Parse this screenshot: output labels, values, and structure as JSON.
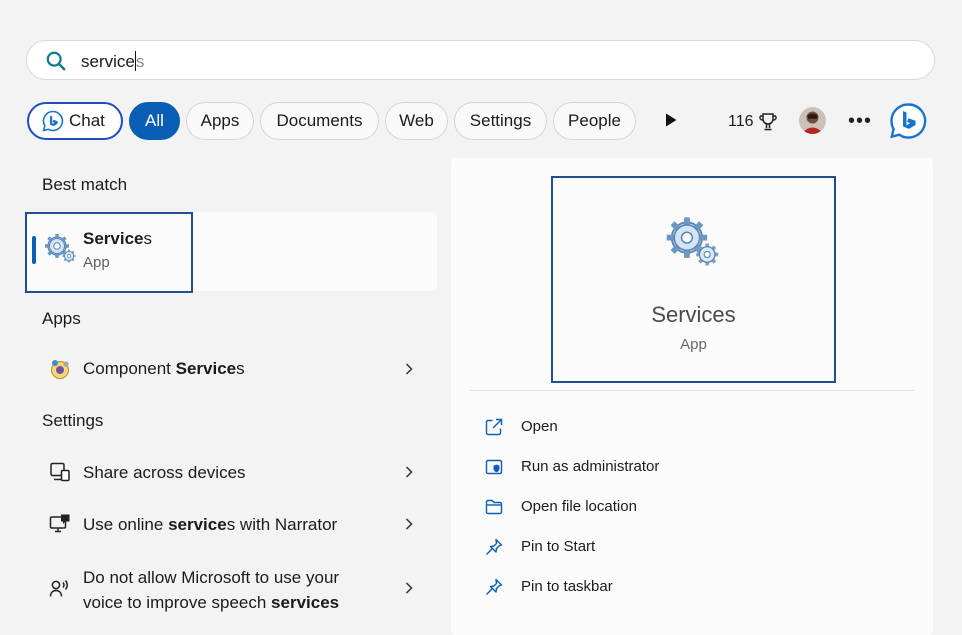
{
  "search": {
    "typed": "service",
    "suggestion_suffix": "s"
  },
  "filters": {
    "chat": "Chat",
    "all": "All",
    "apps": "Apps",
    "documents": "Documents",
    "web": "Web",
    "settings": "Settings",
    "people": "People"
  },
  "rewards": {
    "points": "116"
  },
  "best_match": {
    "heading": "Best match",
    "name_bold": "Service",
    "name_rest": "s",
    "type": "App"
  },
  "apps_section": {
    "heading": "Apps",
    "items": [
      {
        "pre": "Component ",
        "bold": "Service",
        "post": "s"
      }
    ]
  },
  "settings_section": {
    "heading": "Settings",
    "items": [
      {
        "line1": "Share across devices"
      },
      {
        "pre": "Use online ",
        "bold": "service",
        "post": "s with Narrator"
      },
      {
        "line1": "Do not allow Microsoft to use your",
        "pre": "voice to improve speech ",
        "bold": "services"
      }
    ]
  },
  "preview": {
    "name": "Services",
    "type": "App",
    "actions": [
      {
        "label": "Open",
        "icon": "open-external-icon"
      },
      {
        "label": "Run as administrator",
        "icon": "shield-icon"
      },
      {
        "label": "Open file location",
        "icon": "folder-icon"
      },
      {
        "label": "Pin to Start",
        "icon": "pin-icon"
      },
      {
        "label": "Pin to taskbar",
        "icon": "pin-icon"
      }
    ]
  },
  "colors": {
    "accent": "#0a5fb4",
    "focus_border": "#1f4f8f",
    "background": "#f3f3f3"
  }
}
